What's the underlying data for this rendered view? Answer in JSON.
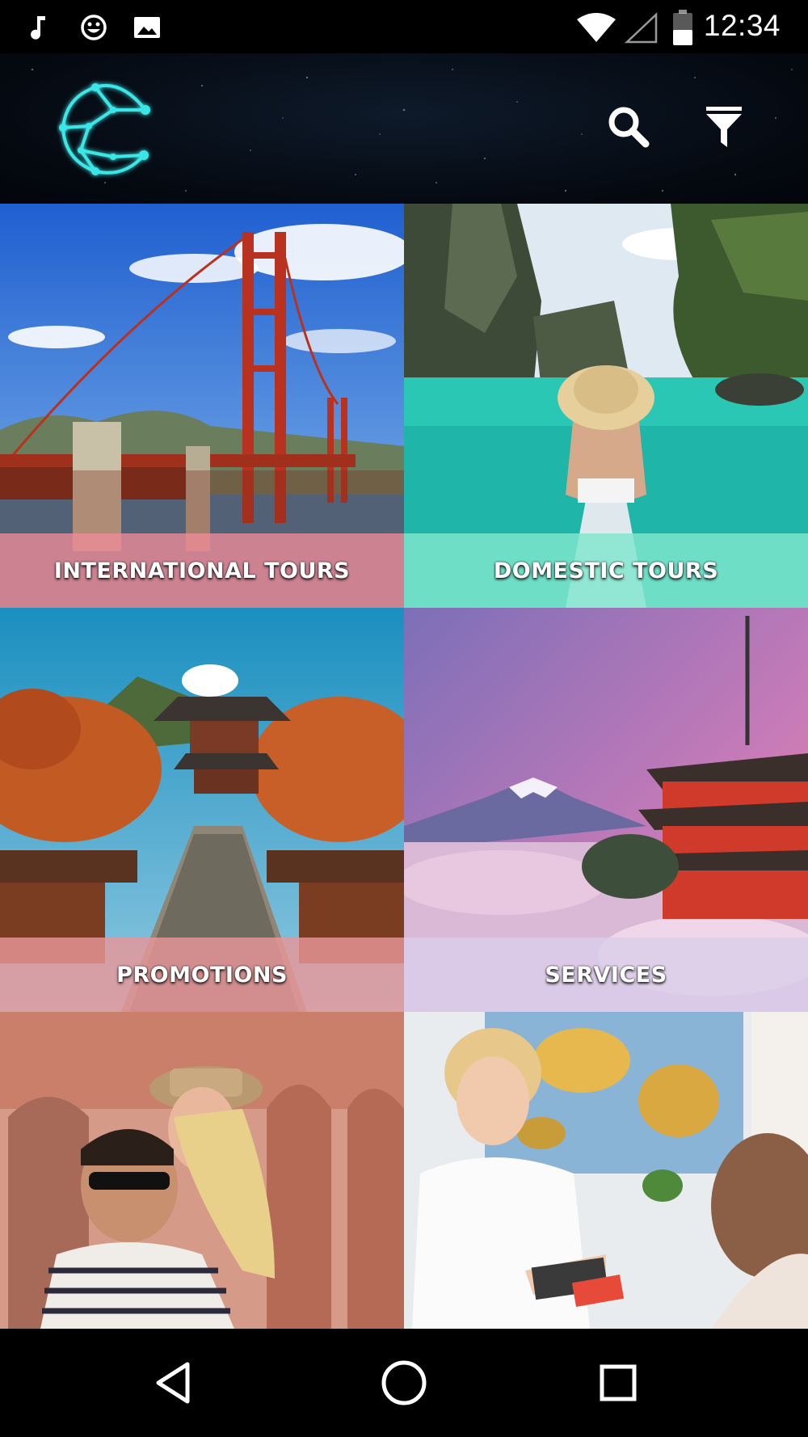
{
  "status_bar": {
    "time": "12:34",
    "left_icons": [
      "music-note-icon",
      "smiley-icon",
      "image-icon"
    ],
    "right_icons": [
      "wifi-icon",
      "signal-icon",
      "battery-icon"
    ]
  },
  "header": {
    "logo": "c-logo",
    "actions": [
      "search-icon",
      "filter-icon"
    ],
    "accent_color": "#3ee6e6"
  },
  "tiles": [
    {
      "label": "INTERNATIONAL TOURS",
      "scene": "golden-gate-bridge",
      "overlay_color": "#e88a96"
    },
    {
      "label": "DOMESTIC TOURS",
      "scene": "lagoon-boat",
      "overlay_color": "#7fe3cc"
    },
    {
      "label": "PROMOTIONS",
      "scene": "korean-pavilion",
      "overlay_color": "#e89a9c"
    },
    {
      "label": "SERVICES",
      "scene": "fuji-pagoda",
      "overlay_color": "#d9c8e6"
    },
    {
      "label": "",
      "scene": "couple-travel"
    },
    {
      "label": "",
      "scene": "travel-agent"
    }
  ],
  "nav_bar": {
    "buttons": [
      "back-icon",
      "home-icon",
      "recents-icon"
    ]
  }
}
